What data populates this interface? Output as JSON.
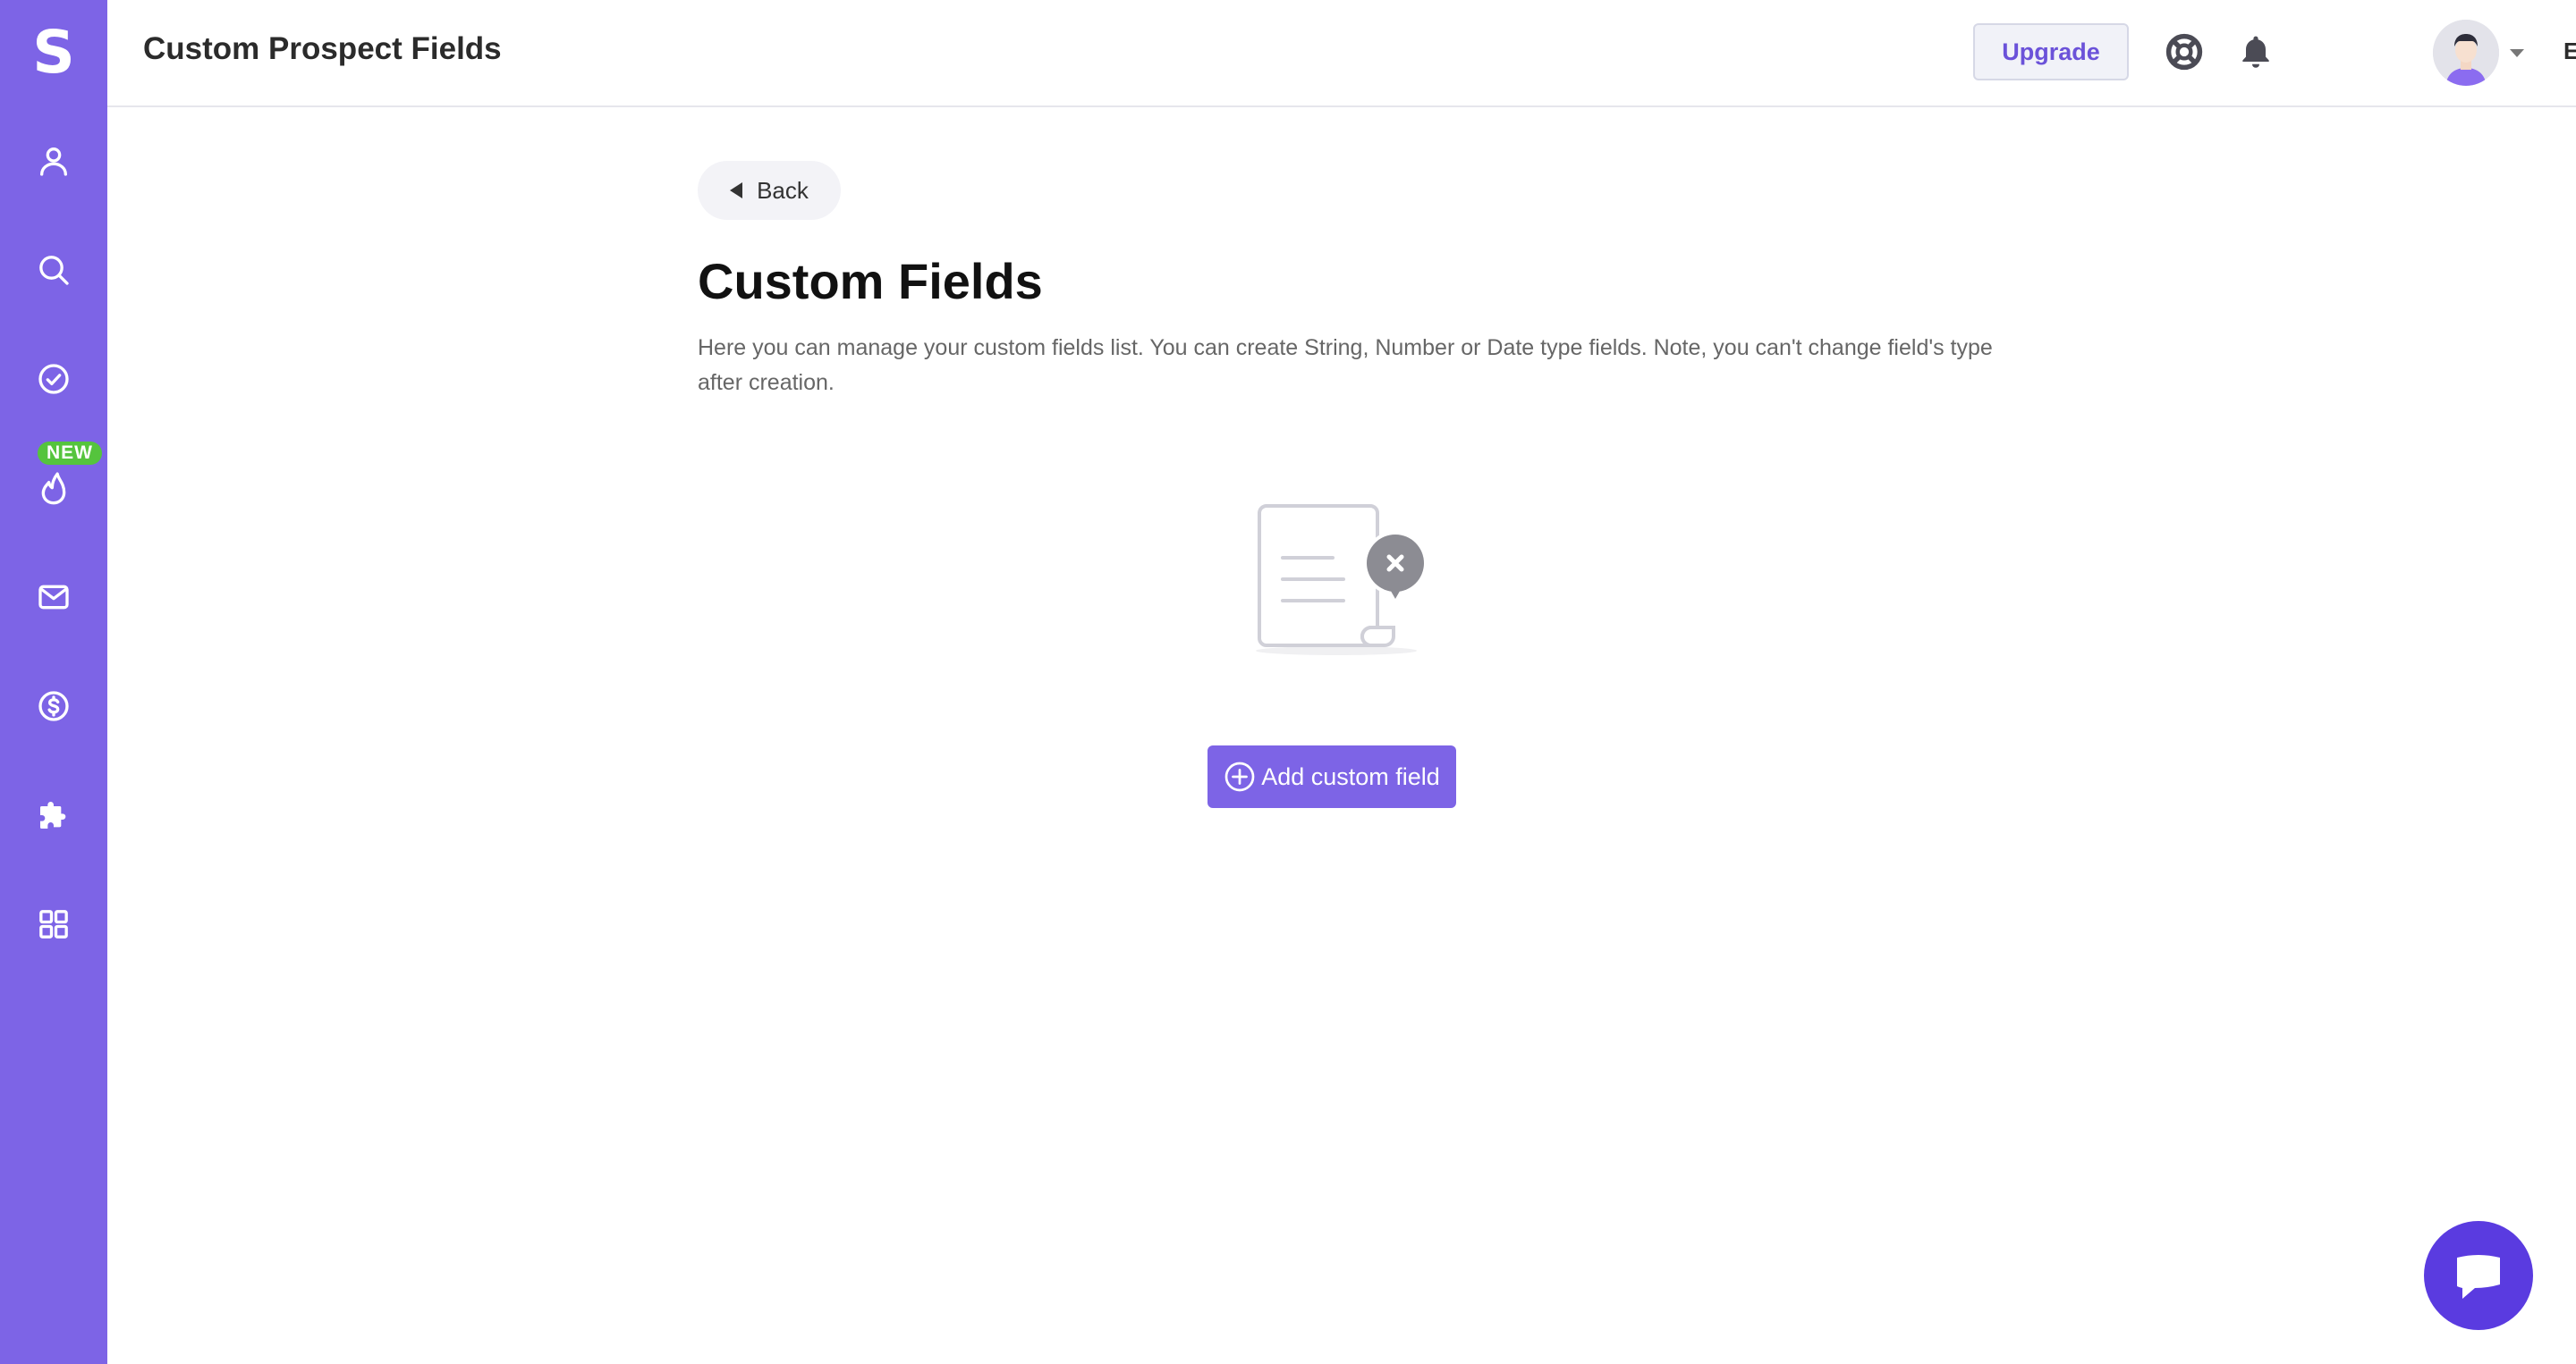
{
  "sidebar": {
    "logo": "S",
    "items": [
      {
        "name": "contacts",
        "icon": "user-icon"
      },
      {
        "name": "search",
        "icon": "search-icon"
      },
      {
        "name": "tasks",
        "icon": "check-circle-icon"
      },
      {
        "name": "warmup",
        "icon": "flame-icon",
        "badge": "NEW"
      },
      {
        "name": "email",
        "icon": "mail-icon"
      },
      {
        "name": "billing",
        "icon": "dollar-circle-icon"
      },
      {
        "name": "integrations",
        "icon": "puzzle-icon"
      },
      {
        "name": "apps",
        "icon": "grid-icon"
      }
    ],
    "background": "#7d64e6",
    "badge_color": "#55c43d"
  },
  "header": {
    "title": "Custom Prospect Fields",
    "upgrade_label": "Upgrade",
    "language": "EN"
  },
  "main": {
    "back_label": "Back",
    "title": "Custom Fields",
    "description": "Here you can manage your custom fields list. You can create String, Number or Date type fields. Note, you can't change field's type after creation.",
    "add_button_label": "Add custom field"
  },
  "colors": {
    "accent": "#7d64e6",
    "chat": "#5a3be0"
  }
}
